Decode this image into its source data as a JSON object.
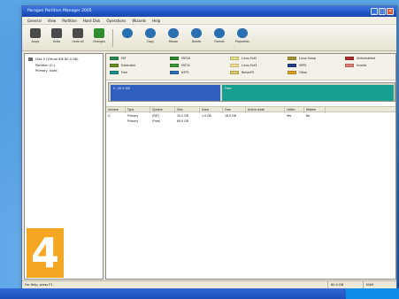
{
  "window": {
    "title": "Paragon Partition Manager 2005",
    "controls": [
      "_",
      "□",
      "✕"
    ]
  },
  "menu": [
    "General",
    "View",
    "Partition",
    "Hard Disk",
    "Operations",
    "Wizards",
    "Help"
  ],
  "toolbar": [
    {
      "label": "Apply",
      "icon": "apply-icon",
      "color": "#4a4a4a"
    },
    {
      "label": "Undo",
      "icon": "undo-icon",
      "color": "#4a4a4a"
    },
    {
      "label": "Undo all",
      "icon": "undo-all-icon",
      "color": "#4a4a4a"
    },
    {
      "label": "Changes",
      "icon": "changes-icon",
      "color": "#2e8b2e"
    },
    {
      "label": "",
      "icon": "disk-icon",
      "color": "#2a6fb0"
    },
    {
      "label": "Copy",
      "icon": "copy-icon",
      "color": "#2a6fb0"
    },
    {
      "label": "Resize",
      "icon": "resize-icon",
      "color": "#2a6fb0"
    },
    {
      "label": "Delete",
      "icon": "delete-icon",
      "color": "#2a6fb0"
    },
    {
      "label": "Format",
      "icon": "format-icon",
      "color": "#2a6fb0"
    },
    {
      "label": "Properties",
      "icon": "properties-icon",
      "color": "#2a6fb0"
    }
  ],
  "tree": [
    "Disk 0 (Virtual IDE 80.0 GB)",
    "Partition (C:)",
    "Primary, Used"
  ],
  "legend": [
    {
      "label": "FAT",
      "color": "#2e8b57"
    },
    {
      "label": "Extended",
      "color": "#6b8e23"
    },
    {
      "label": "Free",
      "color": "#1f8f8f"
    },
    {
      "label": "FAT16",
      "color": "#2e8b2e"
    },
    {
      "label": "FAT32",
      "color": "#3a9d3a"
    },
    {
      "label": "NTFS",
      "color": "#2f6fb5"
    },
    {
      "label": "Linux Ext2",
      "color": "#e3e08a"
    },
    {
      "label": "Linux Ext3",
      "color": "#f0e29a"
    },
    {
      "label": "ReiserFS",
      "color": "#d8c86a"
    },
    {
      "label": "Linux Swap",
      "color": "#a89a3a"
    },
    {
      "label": "HPFS",
      "color": "#1f3f8f"
    },
    {
      "label": "Other",
      "color": "#e0a020"
    },
    {
      "label": "Unformatted",
      "color": "#b03030"
    },
    {
      "label": "Invalid",
      "color": "#e08070"
    }
  ],
  "diskmap": {
    "partition_label": "C: 20.0 GB",
    "free_label": "Free",
    "partition_color": "#2f5fc0",
    "free_color": "#17a08f"
  },
  "table": {
    "columns": [
      "Volume",
      "Type",
      "System",
      "Size",
      "Used",
      "Free",
      "Active state",
      "Letter",
      "Hidden"
    ],
    "rows": [
      [
        "C:",
        "Primary",
        "(FAT)",
        "20.0 GB",
        "1.9 GB",
        "18.0 GB",
        "",
        "Yes",
        "No"
      ],
      [
        "",
        "Primary",
        "(Free)",
        "60.0 GB",
        "",
        "",
        "",
        "",
        ""
      ]
    ]
  },
  "status": {
    "left": "For Help, press F1",
    "mid": "80.0 GB",
    "right": "NUM"
  },
  "step_badge": "4"
}
